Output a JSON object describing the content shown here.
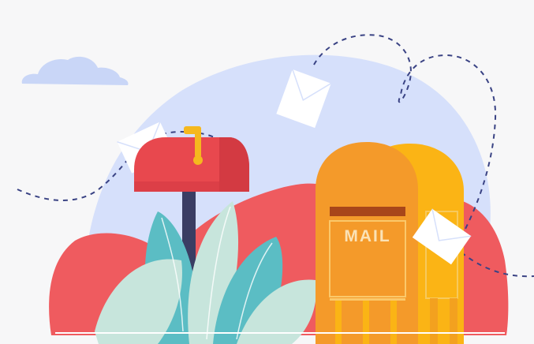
{
  "illustration": {
    "mailbox_label": "MAIL"
  },
  "colors": {
    "background": "#f7f7f8",
    "blob_lavender": "#d6e0fb",
    "cloud": "#c9d6f7",
    "coral": "#ef5b5f",
    "mailbox_red": "#e8484e",
    "flag_yellow": "#f5b81e",
    "post_navy": "#3a3d63",
    "mailbox_orange": "#f49a2a",
    "mailbox_gold": "#fbb415",
    "leaf_teal": "#5bbdc4",
    "leaf_mint": "#c7e5dc",
    "envelope": "#ffffff",
    "dashed_path": "#3a4384"
  },
  "icons": [
    "cloud-icon",
    "envelope-icon",
    "mailbox-icon",
    "leaf-icon"
  ]
}
